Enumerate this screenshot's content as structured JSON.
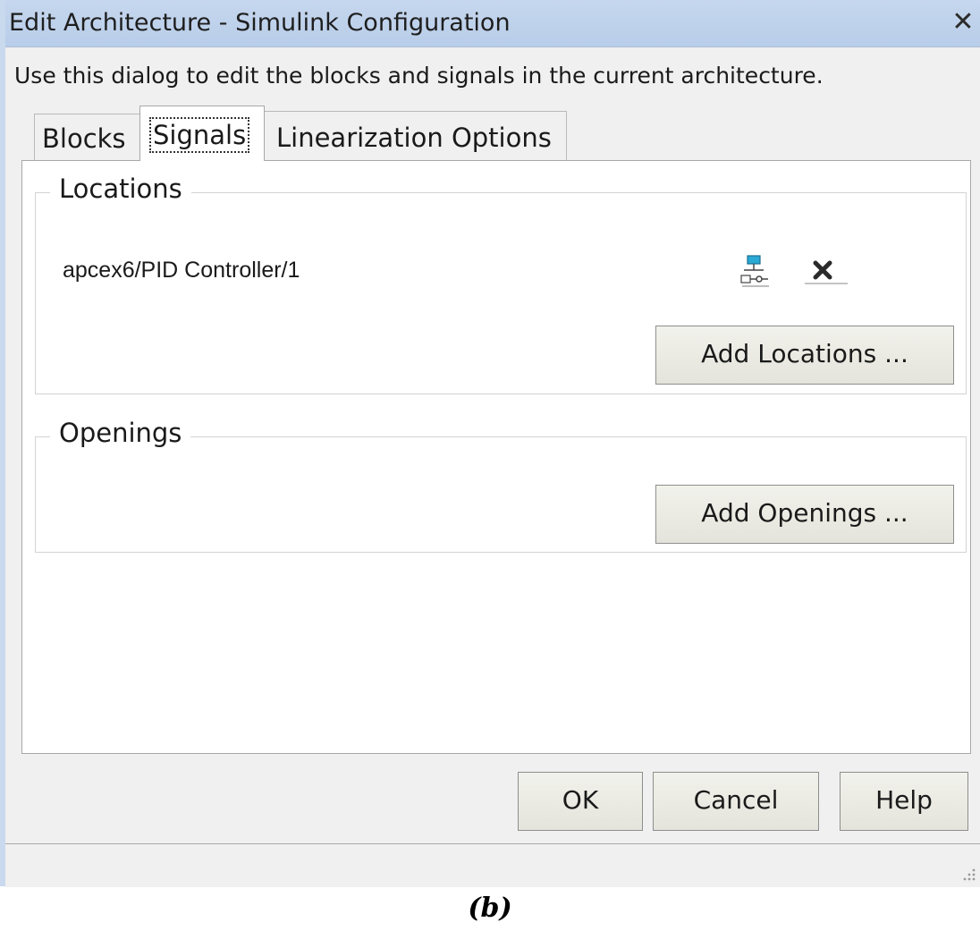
{
  "window": {
    "title": "Edit Architecture - Simulink Configuration",
    "close_label": "✕"
  },
  "instruction": "Use this dialog to edit the blocks and signals in the current architecture.",
  "tabs": [
    {
      "label": "Blocks",
      "selected": false
    },
    {
      "label": "Signals",
      "selected": true
    },
    {
      "label": "Linearization Options",
      "selected": false
    }
  ],
  "locations": {
    "legend": "Locations",
    "items": [
      {
        "path": "apcex6/PID Controller/1",
        "icons": [
          "highlight-signal-icon",
          "remove-icon"
        ]
      }
    ],
    "add_button": "Add Locations ..."
  },
  "openings": {
    "legend": "Openings",
    "items": [],
    "add_button": "Add Openings ..."
  },
  "buttons": {
    "ok": "OK",
    "cancel": "Cancel",
    "help": "Help"
  },
  "caption": "(b)",
  "colors": {
    "titlebar": "#c6d7ee",
    "dialog_bg": "#f0f0f0",
    "panel_bg": "#ffffff",
    "button_bg": "#e8e8e0",
    "icon_accent": "#29a9d6"
  }
}
